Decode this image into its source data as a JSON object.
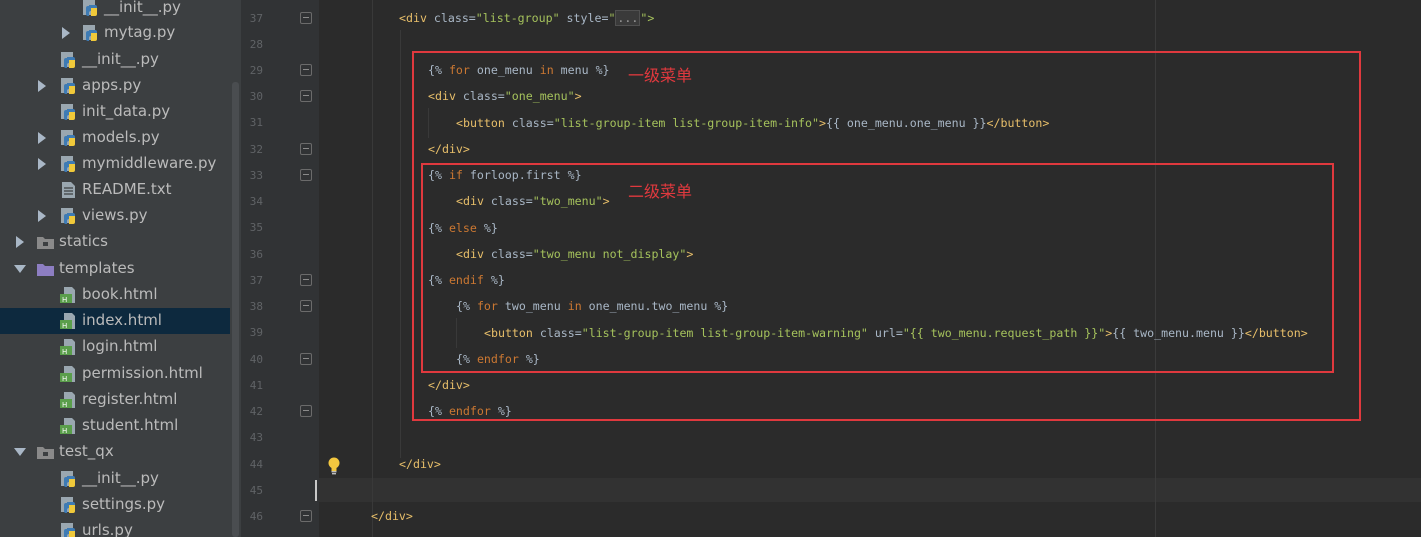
{
  "project_tree": {
    "items": [
      {
        "label": "__init__.py",
        "icon": "python-file-icon"
      },
      {
        "label": "mytag.py",
        "icon": "python-file-icon"
      },
      {
        "label": "__init__.py",
        "icon": "python-file-icon"
      },
      {
        "label": "apps.py",
        "icon": "python-file-icon"
      },
      {
        "label": "init_data.py",
        "icon": "python-file-icon"
      },
      {
        "label": "models.py",
        "icon": "python-file-icon"
      },
      {
        "label": "mymiddleware.py",
        "icon": "python-file-icon"
      },
      {
        "label": "README.txt",
        "icon": "text-file-icon"
      },
      {
        "label": "views.py",
        "icon": "python-file-icon"
      },
      {
        "label": "statics",
        "icon": "folder-icon"
      },
      {
        "label": "templates",
        "icon": "template-folder-icon"
      },
      {
        "label": "book.html",
        "icon": "html-file-icon"
      },
      {
        "label": "index.html",
        "icon": "html-file-icon",
        "selected": true
      },
      {
        "label": "login.html",
        "icon": "html-file-icon"
      },
      {
        "label": "permission.html",
        "icon": "html-file-icon"
      },
      {
        "label": "register.html",
        "icon": "html-file-icon"
      },
      {
        "label": "student.html",
        "icon": "html-file-icon"
      },
      {
        "label": "test_qx",
        "icon": "folder-icon"
      },
      {
        "label": "__init__.py",
        "icon": "python-file-icon"
      },
      {
        "label": "settings.py",
        "icon": "python-file-icon"
      },
      {
        "label": "urls.py",
        "icon": "python-file-icon"
      }
    ]
  },
  "editor": {
    "line_numbers": [
      "37",
      "28",
      "29",
      "30",
      "31",
      "32",
      "33",
      "34",
      "35",
      "36",
      "37",
      "38",
      "39",
      "40",
      "41",
      "42",
      "43",
      "44",
      "45",
      "46"
    ],
    "annotations": {
      "level1": "一级菜单",
      "level2": "二级菜单"
    },
    "lines": {
      "l37a_open": "<div ",
      "l37a_attr1": "class=",
      "l37a_val1": "\"list-group\"",
      "l37a_attr2": " style=",
      "l37a_val2": "\"",
      "l37a_fold": "...",
      "l37a_end": "\">",
      "l29_a": "{% ",
      "l29_kw1": "for",
      "l29_b": " one_menu ",
      "l29_kw2": "in",
      "l29_c": " menu %}",
      "l30_open": "<div ",
      "l30_attr": "class=",
      "l30_val": "\"one_menu\"",
      "l30_end": ">",
      "l31_open": "<button ",
      "l31_attr": "class=",
      "l31_val": "\"list-group-item list-group-item-info\"",
      "l31_gt": ">",
      "l31_tpl": "{{ one_menu.one_menu }}",
      "l31_close": "</button>",
      "l32": "</div>",
      "l33_a": "{% ",
      "l33_kw": "if",
      "l33_b": " forloop.first %}",
      "l34_open": "<div ",
      "l34_attr": "class=",
      "l34_val": "\"two_menu\"",
      "l34_end": ">",
      "l35_a": "{% ",
      "l35_kw": "else",
      "l35_b": " %}",
      "l36_open": "<div ",
      "l36_attr": "class=",
      "l36_val": "\"two_menu not_display\"",
      "l36_end": ">",
      "l37b_a": "{% ",
      "l37b_kw": "endif",
      "l37b_b": " %}",
      "l38_a": "{% ",
      "l38_kw1": "for",
      "l38_b": " two_menu ",
      "l38_kw2": "in",
      "l38_c": " one_menu.two_menu %}",
      "l39_open": "<button ",
      "l39_attr1": "class=",
      "l39_val1": "\"list-group-item list-group-item-warning\"",
      "l39_attr2": " url=",
      "l39_val2": "\"{{ two_menu.request_path }}\"",
      "l39_gt": ">",
      "l39_tpl": "{{ two_menu.menu }}",
      "l39_close": "</button>",
      "l40_a": "{% ",
      "l40_kw": "endfor",
      "l40_b": " %}",
      "l41": "</div>",
      "l42_a": "{% ",
      "l42_kw": "endfor",
      "l42_b": " %}",
      "l44": "</div>",
      "l46": "</div>"
    }
  },
  "colors": {
    "tag": "#e8bf6a",
    "string": "#a5c25c",
    "keyword": "#cc7832",
    "text": "#a9b7c6",
    "annotation": "#e0393e"
  }
}
